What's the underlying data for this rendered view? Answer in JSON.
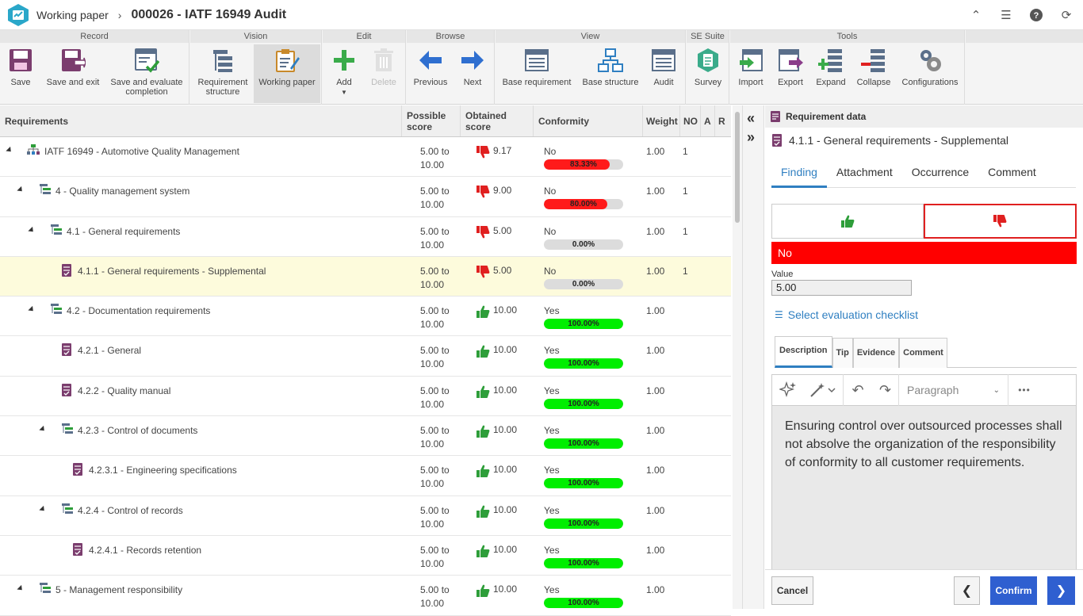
{
  "title_bar": {
    "module": "Working paper",
    "separator": "›",
    "title": "000026 - IATF 16949 Audit"
  },
  "ribbon": {
    "groups": {
      "record": "Record",
      "vision": "Vision",
      "edit": "Edit",
      "browse": "Browse",
      "view": "View",
      "se_suite": "SE Suite",
      "tools": "Tools"
    },
    "buttons": {
      "save": "Save",
      "save_exit": "Save and exit",
      "save_eval_1": "Save and evaluate",
      "save_eval_2": "completion",
      "req_struct_1": "Requirement",
      "req_struct_2": "structure",
      "working_paper": "Working paper",
      "add": "Add",
      "delete": "Delete",
      "previous": "Previous",
      "next": "Next",
      "base_requirement": "Base requirement",
      "base_structure": "Base structure",
      "audit": "Audit",
      "survey": "Survey",
      "import": "Import",
      "export": "Export",
      "expand": "Expand",
      "collapse": "Collapse",
      "configurations": "Configurations"
    }
  },
  "grid": {
    "headers": {
      "requirements": "Requirements",
      "possible_1": "Possible",
      "possible_2": "score",
      "obtained_1": "Obtained",
      "obtained_2": "score",
      "conformity": "Conformity",
      "weight": "Weight",
      "no": "NO",
      "a": "A",
      "r": "R"
    },
    "rows": [
      {
        "label": "IATF 16949 - Automotive Quality Management",
        "score_a": "5.00 to",
        "score_b": "10.00",
        "obtained": "9.17",
        "conf": "No",
        "pct": "83.33%",
        "pct_value": 83.33,
        "weight": "1.00",
        "no": "1"
      },
      {
        "label": "4 - Quality management system",
        "score_a": "5.00 to",
        "score_b": "10.00",
        "obtained": "9.00",
        "conf": "No",
        "pct": "80.00%",
        "pct_value": 80,
        "weight": "1.00",
        "no": "1"
      },
      {
        "label": "4.1 - General requirements",
        "score_a": "5.00 to",
        "score_b": "10.00",
        "obtained": "5.00",
        "conf": "No",
        "pct": "0.00%",
        "pct_value": 0,
        "weight": "1.00",
        "no": "1"
      },
      {
        "label": "4.1.1 - General requirements - Supplemental",
        "score_a": "5.00 to",
        "score_b": "10.00",
        "obtained": "5.00",
        "conf": "No",
        "pct": "0.00%",
        "pct_value": 0,
        "weight": "1.00",
        "no": "1"
      },
      {
        "label": "4.2 - Documentation requirements",
        "score_a": "5.00 to",
        "score_b": "10.00",
        "obtained": "10.00",
        "conf": "Yes",
        "pct": "100.00%",
        "pct_value": 100,
        "weight": "1.00",
        "no": ""
      },
      {
        "label": "4.2.1 - General",
        "score_a": "5.00 to",
        "score_b": "10.00",
        "obtained": "10.00",
        "conf": "Yes",
        "pct": "100.00%",
        "pct_value": 100,
        "weight": "1.00",
        "no": ""
      },
      {
        "label": "4.2.2 - Quality manual",
        "score_a": "5.00 to",
        "score_b": "10.00",
        "obtained": "10.00",
        "conf": "Yes",
        "pct": "100.00%",
        "pct_value": 100,
        "weight": "1.00",
        "no": ""
      },
      {
        "label": "4.2.3 - Control of documents",
        "score_a": "5.00 to",
        "score_b": "10.00",
        "obtained": "10.00",
        "conf": "Yes",
        "pct": "100.00%",
        "pct_value": 100,
        "weight": "1.00",
        "no": ""
      },
      {
        "label": "4.2.3.1 - Engineering specifications",
        "score_a": "5.00 to",
        "score_b": "10.00",
        "obtained": "10.00",
        "conf": "Yes",
        "pct": "100.00%",
        "pct_value": 100,
        "weight": "1.00",
        "no": ""
      },
      {
        "label": "4.2.4 - Control of records",
        "score_a": "5.00 to",
        "score_b": "10.00",
        "obtained": "10.00",
        "conf": "Yes",
        "pct": "100.00%",
        "pct_value": 100,
        "weight": "1.00",
        "no": ""
      },
      {
        "label": "4.2.4.1 - Records retention",
        "score_a": "5.00 to",
        "score_b": "10.00",
        "obtained": "10.00",
        "conf": "Yes",
        "pct": "100.00%",
        "pct_value": 100,
        "weight": "1.00",
        "no": ""
      },
      {
        "label": "5 - Management responsibility",
        "score_a": "5.00 to",
        "score_b": "10.00",
        "obtained": "10.00",
        "conf": "Yes",
        "pct": "100.00%",
        "pct_value": 100,
        "weight": "1.00",
        "no": ""
      }
    ]
  },
  "panel": {
    "header": "Requirement data",
    "req_title": "4.1.1 - General requirements - Supplemental",
    "tabs": [
      "Finding",
      "Attachment",
      "Occurrence",
      "Comment"
    ],
    "result": "No",
    "value_label": "Value",
    "value": "5.00",
    "checklist": "Select evaluation checklist",
    "desc_tabs": [
      "Description",
      "Tip",
      "Evidence",
      "Comment"
    ],
    "paragraph": "Paragraph",
    "more": "•••",
    "description": "Ensuring control over outsourced processes shall not absolve the organization of the responsibility of conformity to all customer requirements.",
    "cancel": "Cancel",
    "confirm": "Confirm"
  },
  "colors": {
    "accent": "#2f7fc1",
    "negative": "#ff0000",
    "positive_bar": "#00ee00",
    "negative_bar": "#ff1a1a",
    "thumb_up": "#2e9e3a",
    "thumb_down": "#e02020",
    "selected_row": "#fdfbdc"
  }
}
